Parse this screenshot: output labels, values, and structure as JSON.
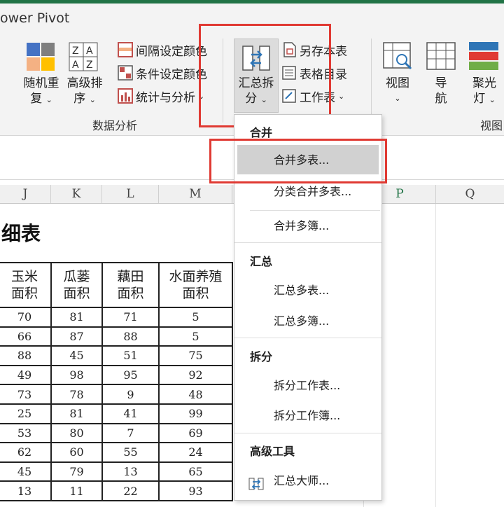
{
  "window": {
    "tab_partial": "ower Pivot"
  },
  "ribbon": {
    "random_label_1": "随机重",
    "random_label_2": "复",
    "sort_label_1": "高级排",
    "sort_label_2": "序",
    "interval_color": "间隔设定颜色",
    "cond_color": "条件设定颜色",
    "stats": "统计与分析",
    "merge_split_1": "汇总拆",
    "merge_split_2": "分",
    "save_as_table": "另存本表",
    "table_index": "表格目录",
    "worksheet": "工作表",
    "view_label": "视图",
    "nav_label_1": "导",
    "nav_label_2": "航",
    "spot_label_1": "聚光",
    "spot_label_2": "灯",
    "group_data_analysis": "数据分析",
    "group_view": "视图"
  },
  "columns": [
    "J",
    "K",
    "L",
    "M",
    "P",
    "Q"
  ],
  "sheet": {
    "title_partial": "细表",
    "headers": [
      [
        "玉米",
        "面积"
      ],
      [
        "瓜蒌",
        "面积"
      ],
      [
        "藕田",
        "面积"
      ],
      [
        "水面养殖",
        "面积"
      ]
    ],
    "rows": [
      [
        70,
        81,
        71,
        5
      ],
      [
        66,
        87,
        88,
        5
      ],
      [
        88,
        45,
        51,
        75
      ],
      [
        49,
        98,
        95,
        92
      ],
      [
        73,
        78,
        9,
        48
      ],
      [
        25,
        81,
        41,
        99
      ],
      [
        53,
        80,
        7,
        69
      ],
      [
        62,
        60,
        55,
        24
      ],
      [
        45,
        79,
        13,
        65
      ],
      [
        13,
        11,
        22,
        93
      ]
    ]
  },
  "menu": {
    "sec_merge": "合并",
    "merge_multi_sheets": "合并多表...",
    "merge_by_category": "分类合并多表...",
    "merge_multi_books": "合并多簿...",
    "sec_summary": "汇总",
    "summary_multi_sheets": "汇总多表...",
    "summary_multi_books": "汇总多簿...",
    "sec_split": "拆分",
    "split_sheet": "拆分工作表...",
    "split_book": "拆分工作簿...",
    "sec_advanced": "高级工具",
    "summary_master": "汇总大师..."
  },
  "colors": {
    "accent_green": "#217346",
    "highlight_red": "#e03a33",
    "menu_hover": "#d1d1d1"
  }
}
